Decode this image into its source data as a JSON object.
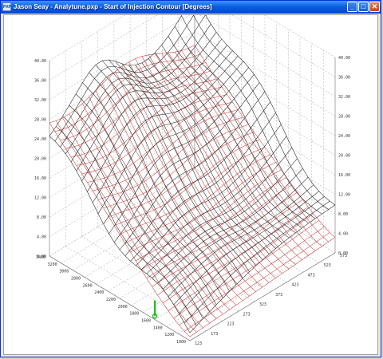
{
  "window": {
    "icon_text": "PXP",
    "title": "Jason Seay - Analytune.pxp - Start of Injection Contour [Degrees]",
    "controls": {
      "minimize": "_",
      "maximize": "□",
      "close": "✕"
    }
  },
  "chart_data": {
    "type": "surface3d",
    "title": "Start of Injection Contour [Degrees]",
    "z_ticks": [
      "0.00",
      "4.00",
      "8.00",
      "12.00",
      "16.00",
      "20.00",
      "24.00",
      "28.00",
      "32.00",
      "36.00",
      "40.00"
    ],
    "zlim": [
      0,
      40
    ],
    "left_axis_ticks": [
      "1000",
      "1200",
      "1400",
      "1600",
      "1800",
      "2000",
      "2200",
      "2400",
      "2600",
      "2800",
      "3000",
      "3200",
      "3400"
    ],
    "right_axis_ticks": [
      "123",
      "173",
      "223",
      "273",
      "323",
      "373",
      "423",
      "473",
      "523",
      "573"
    ],
    "series": [
      {
        "color": "#202020"
      },
      {
        "color": "#c84040"
      }
    ],
    "marker_color": "#18c018",
    "grid": true
  }
}
